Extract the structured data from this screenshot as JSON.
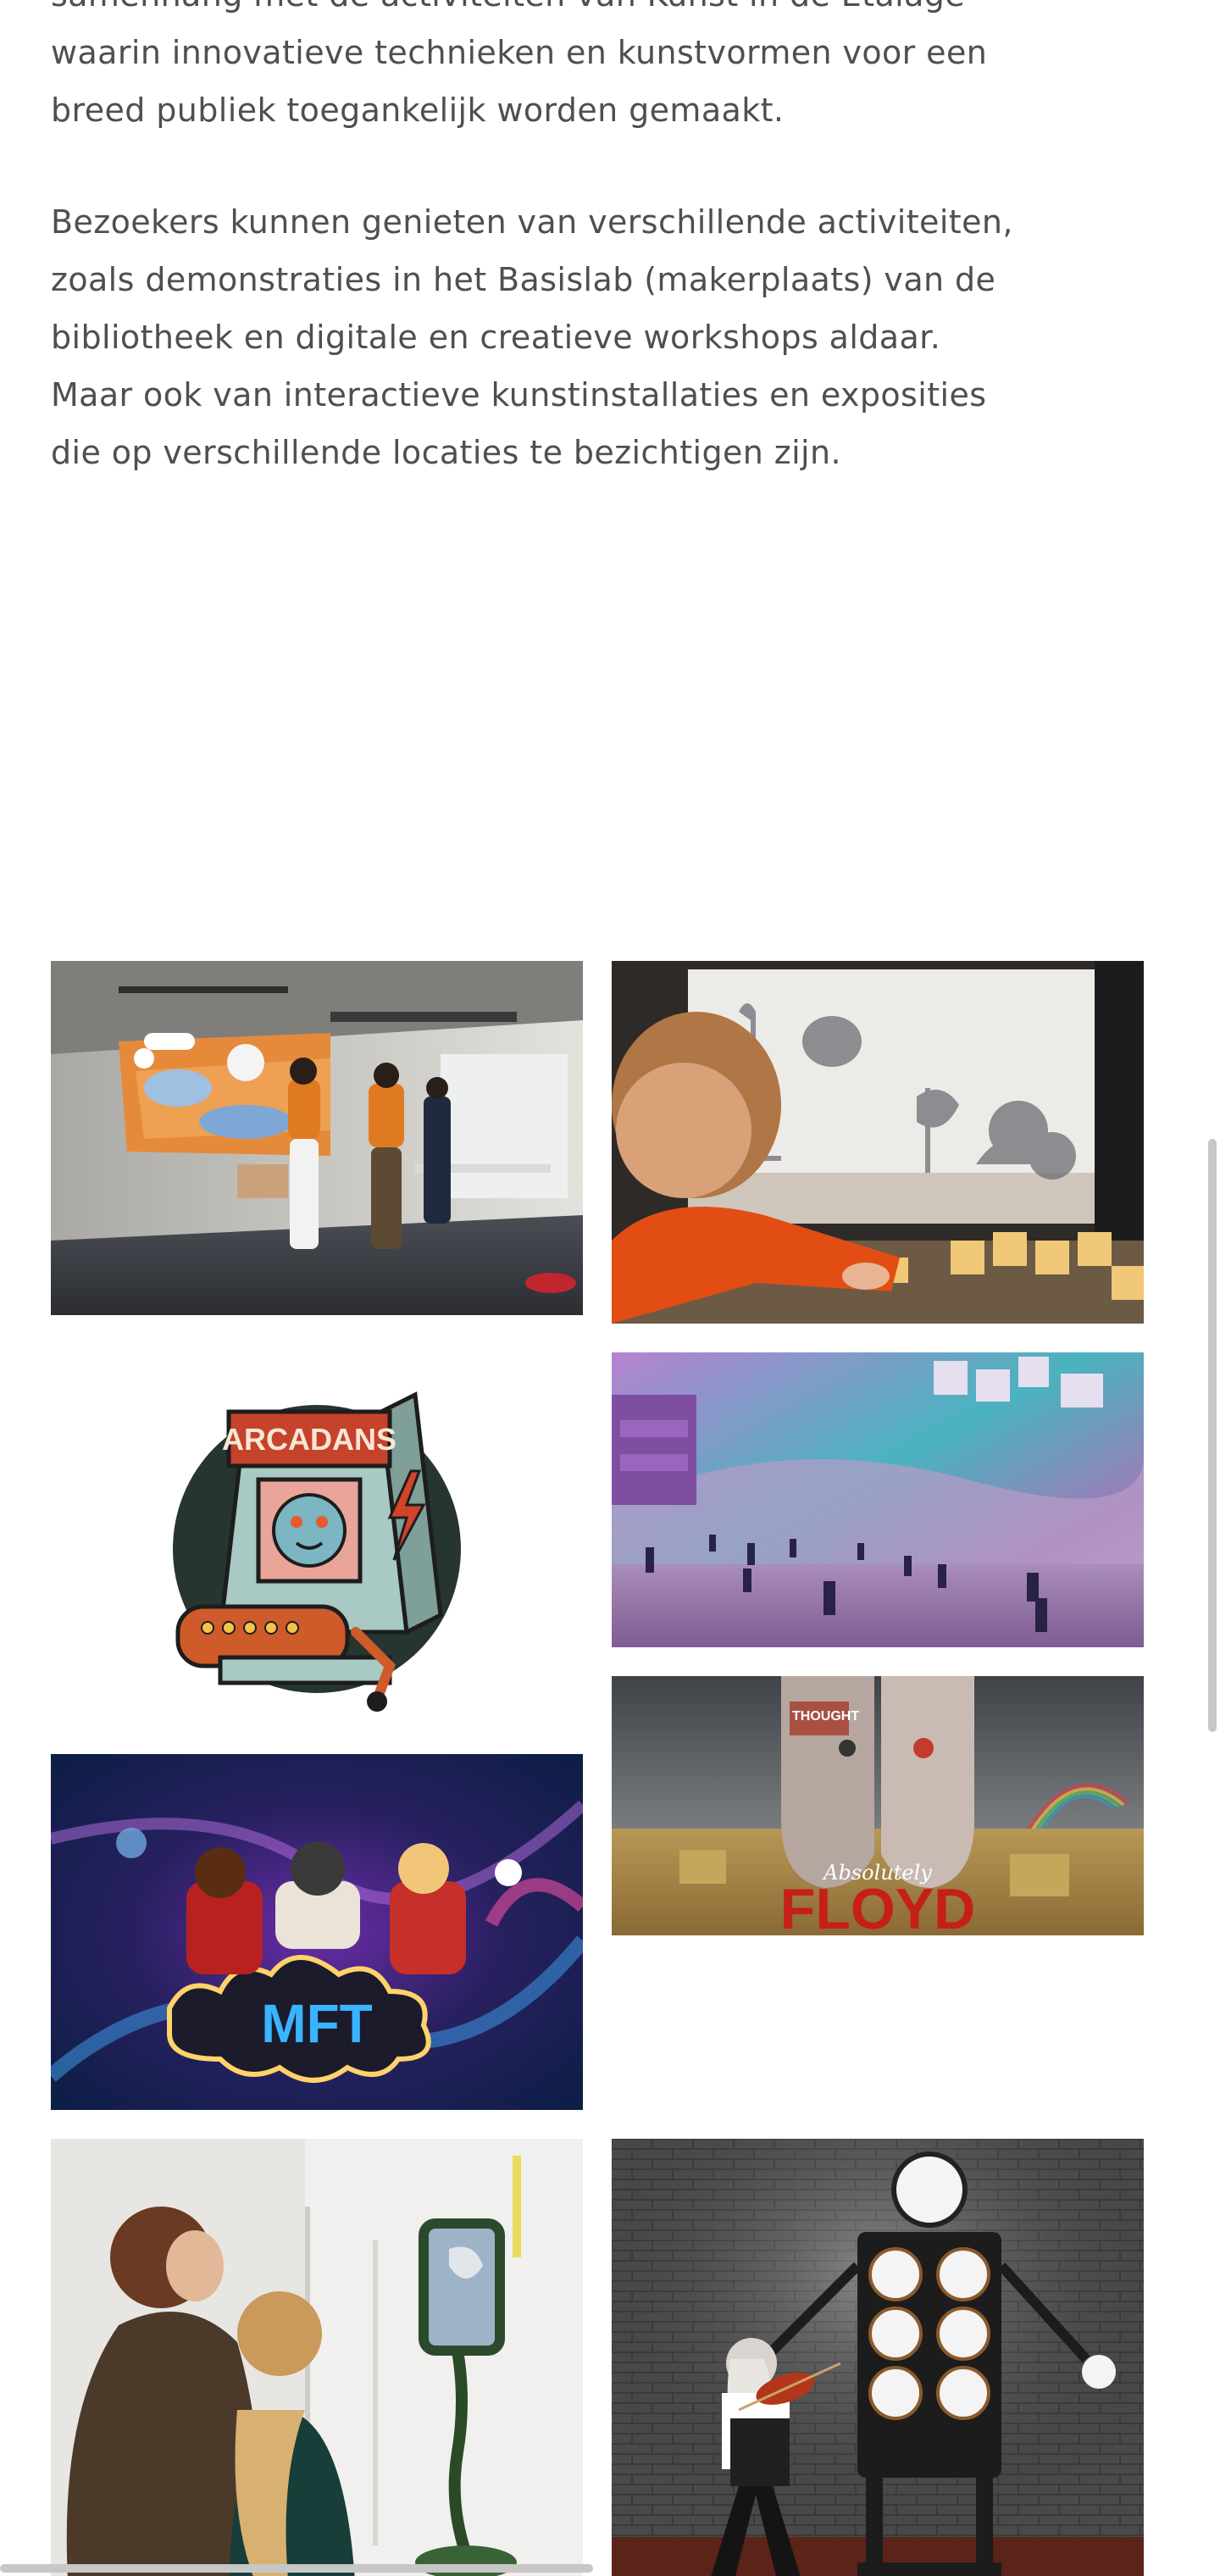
{
  "article": {
    "paragraph_1": "samenhang met de activiteiten van Kunst in de Etalage\nwaarin innovatieve technieken en kunstvormen voor een\nbreed publiek toegankelijk worden gemaakt.",
    "paragraph_2": "Bezoekers kunnen genieten van verschillende activiteiten,\nzoals demonstraties in het Basislab (makerplaats) van de\nbibliotheek en digitale en creatieve workshops aldaar.\nMaar ook van interactieve kunstinstallaties en exposities\ndie op verschillende locaties te bezichtigen zijn."
  },
  "gallery": {
    "images": [
      {
        "name": "photo-interactive-projection-dance",
        "subject": "people dancing in front of projection wall"
      },
      {
        "name": "photo-shadow-play-child",
        "subject": "child playing with shadow theatre blocks"
      },
      {
        "name": "illustration-arcadians-machine",
        "subject": "arcade machine illustration",
        "label": "ARCADANS"
      },
      {
        "name": "photo-virtual-world-purple",
        "subject": "virtual purple landscape with avatars"
      },
      {
        "name": "poster-absolutely-floyd",
        "subject": "two metal heads in field with rainbow",
        "label": "FLOYD",
        "script_label": "Absolutely",
        "sign_text": "THOUGHT"
      },
      {
        "name": "poster-mft-kids",
        "subject": "kids around glowing MFT logo",
        "label": "MFT"
      },
      {
        "name": "photo-mirror-installation",
        "subject": "woman and girl looking at mirror installation"
      },
      {
        "name": "photo-violin-robot",
        "subject": "violinist in front of speaker robot"
      }
    ]
  },
  "colors": {
    "text": "#4f4f4f",
    "background": "#ffffff",
    "scrollbar": "#c7c7c7"
  }
}
